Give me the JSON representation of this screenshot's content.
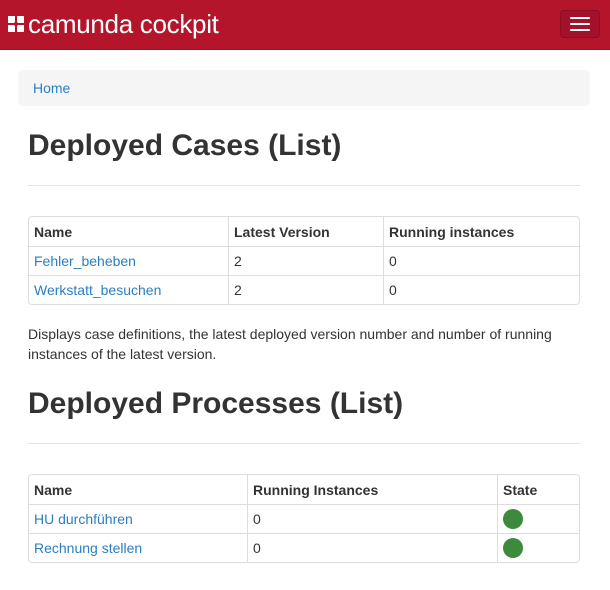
{
  "app": {
    "brand": "camunda cockpit",
    "menu_toggle": "menu-toggle"
  },
  "breadcrumb": {
    "home": "Home"
  },
  "cases": {
    "title": "Deployed Cases (List)",
    "headers": [
      "Name",
      "Latest Version",
      "Running instances"
    ],
    "rows": [
      {
        "name": "Fehler_beheben",
        "version": "2",
        "running": "0"
      },
      {
        "name": "Werkstatt_besuchen",
        "version": "2",
        "running": "0"
      }
    ],
    "description": "Displays case definitions, the latest deployed version number and number of running instances of the latest version."
  },
  "processes": {
    "title": "Deployed Processes (List)",
    "headers": [
      "Name",
      "Running Instances",
      "State"
    ],
    "rows": [
      {
        "name": "HU durchführen",
        "running": "0",
        "state_color": "#3d8a3d"
      },
      {
        "name": "Rechnung stellen",
        "running": "0",
        "state_color": "#3d8a3d"
      }
    ]
  },
  "colors": {
    "navbar": "#b5152b",
    "link": "#2a7fc1",
    "state_ok": "#3d8a3d"
  }
}
